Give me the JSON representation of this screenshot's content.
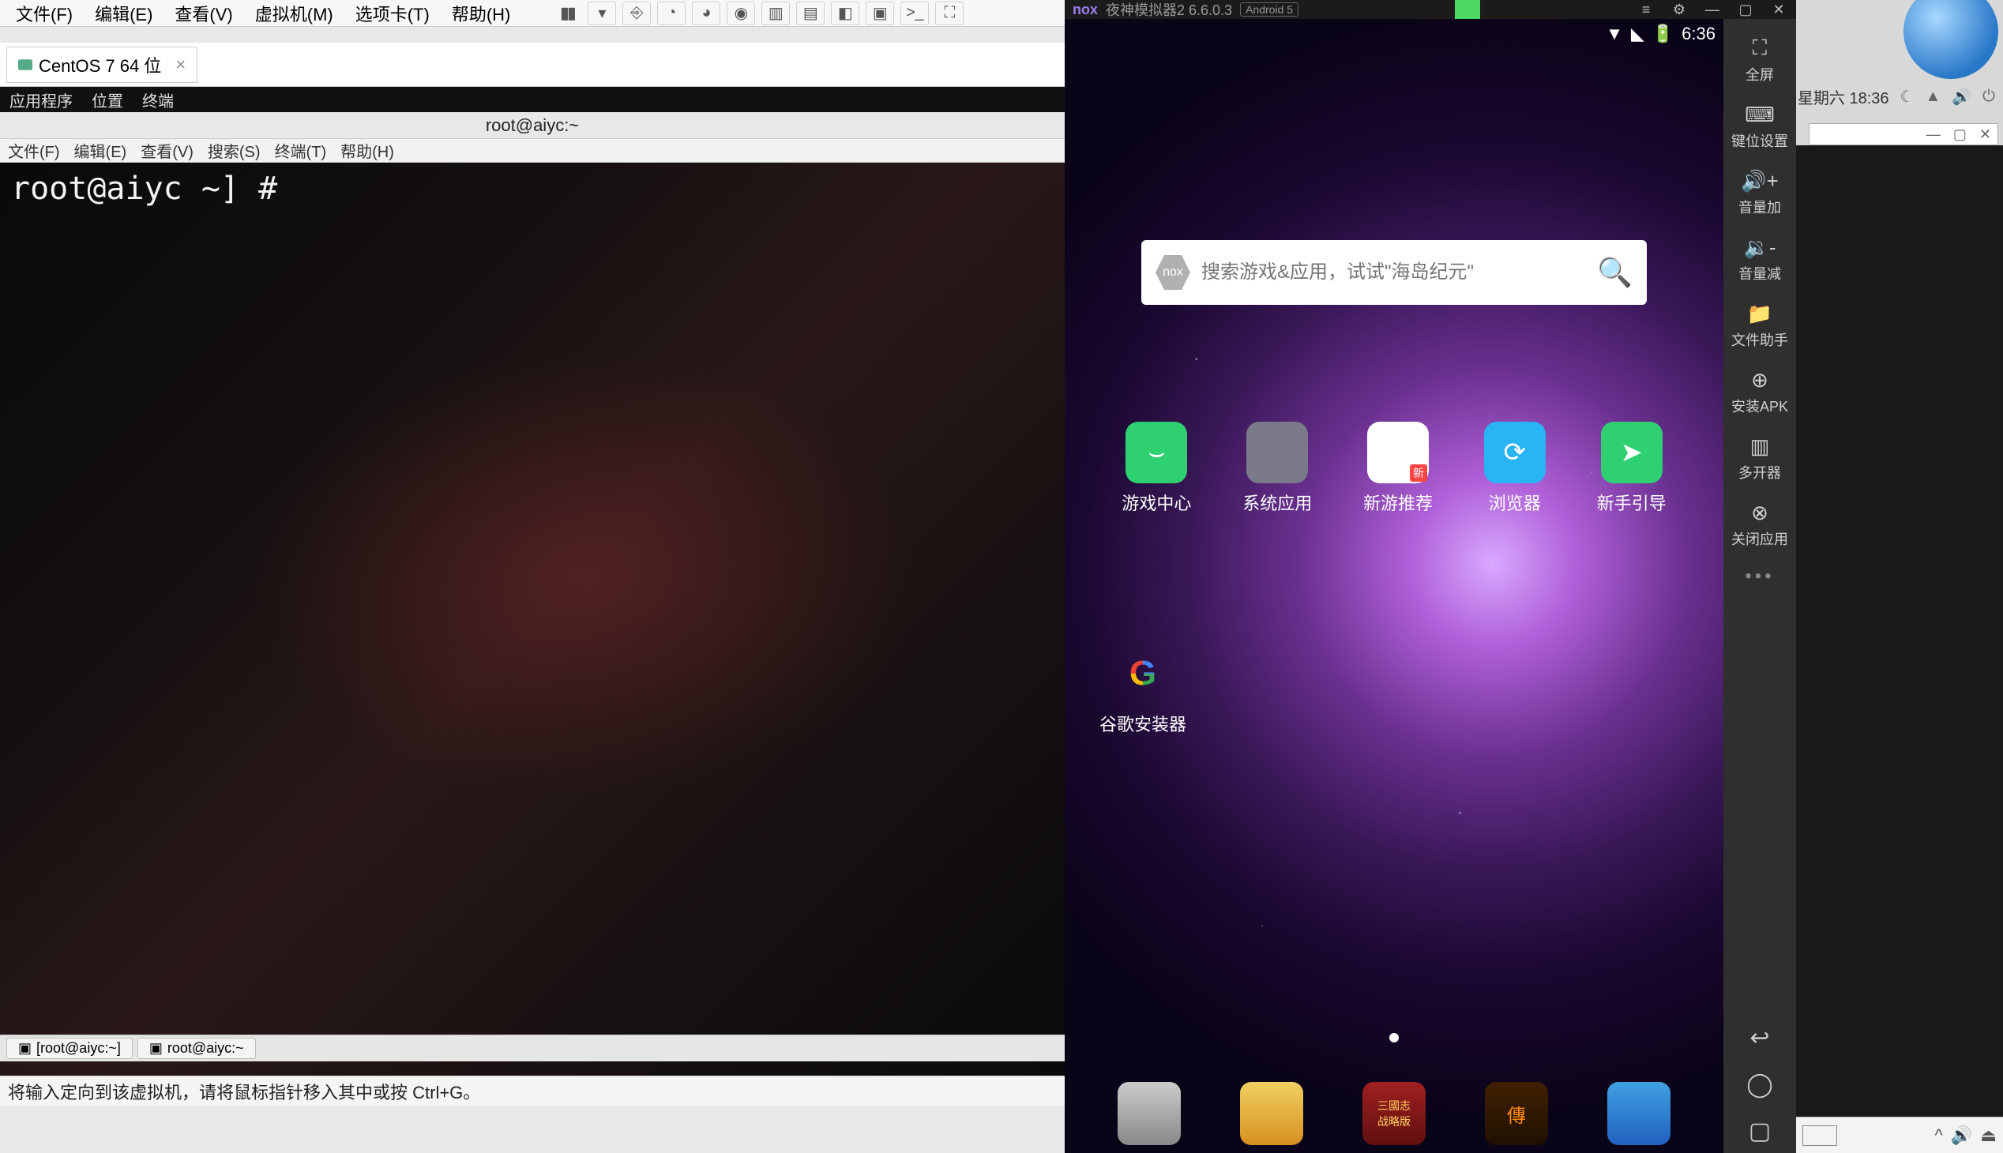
{
  "vm_menu": [
    "文件(F)",
    "编辑(E)",
    "查看(V)",
    "虚拟机(M)",
    "选项卡(T)",
    "帮助(H)"
  ],
  "vm_tab": {
    "label": "CentOS 7 64 位"
  },
  "gnome_top": [
    "应用程序",
    "位置",
    "终端"
  ],
  "guest_title": "root@aiyc:~",
  "term_menu": [
    "文件(F)",
    "编辑(E)",
    "查看(V)",
    "搜索(S)",
    "终端(T)",
    "帮助(H)"
  ],
  "prompt": "root@aiyc ~] #",
  "task1": "[root@aiyc:~]",
  "task2": "root@aiyc:~",
  "status_msg": "将输入定向到该虚拟机，请将鼠标指针移入其中或按 Ctrl+G。",
  "nox": {
    "brand": "nox",
    "title": "夜神模拟器2 6.6.0.3",
    "android_tag": "Android 5",
    "time": "6:36",
    "search_ph": "搜索游戏&应用，试试\"海岛纪元\"",
    "apps": [
      {
        "label": "游戏中心",
        "bg": "#2FD072"
      },
      {
        "label": "系统应用",
        "bg": "#7a7a8a"
      },
      {
        "label": "新游推荐",
        "bg": "#ffffff"
      },
      {
        "label": "浏览器",
        "bg": "#28B4F5"
      },
      {
        "label": "新手引导",
        "bg": "#2FD072"
      }
    ],
    "app_google": "谷歌安装器",
    "side": [
      {
        "label": "全屏",
        "icon": "⛶"
      },
      {
        "label": "键位设置",
        "icon": "⌨"
      },
      {
        "label": "音量加",
        "icon": "🔊+"
      },
      {
        "label": "音量减",
        "icon": "🔉-"
      },
      {
        "label": "文件助手",
        "icon": "📁"
      },
      {
        "label": "安装APK",
        "icon": "⊕"
      },
      {
        "label": "多开器",
        "icon": "▥"
      },
      {
        "label": "关闭应用",
        "icon": "⊗"
      }
    ]
  },
  "host": {
    "datetime": "星期六 18:36"
  }
}
